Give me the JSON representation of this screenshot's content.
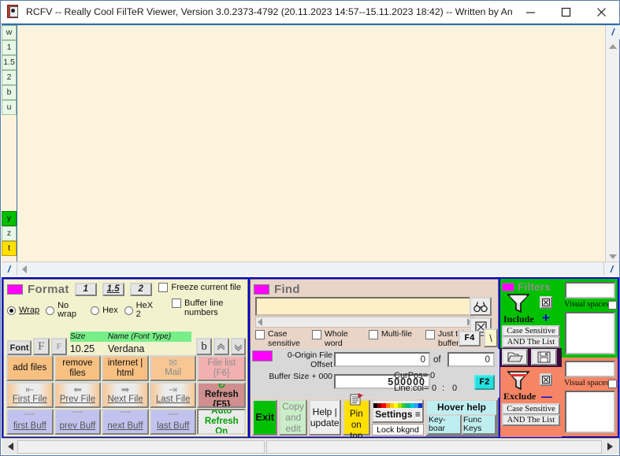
{
  "window": {
    "title": "RCFV -- Really Cool FilTeR Viewer, Version 3.0.2373-4792 (20.11.2023 14:57--15.11.2023 18:42) -- Written by Antho...",
    "icon": "book-icon",
    "minimize": "minimize-icon",
    "maximize": "maximize-icon",
    "close": "close-icon"
  },
  "viewer": {
    "content": "",
    "gutter_buttons": [
      {
        "label": "w",
        "style": "plain"
      },
      {
        "label": "1",
        "style": "plain"
      },
      {
        "label": "1.5",
        "style": "plain"
      },
      {
        "label": "2",
        "style": "plain"
      },
      {
        "label": "b",
        "style": "plain"
      },
      {
        "label": "u",
        "style": "plain"
      }
    ],
    "gutter_buttons_lower": [
      {
        "label": "y",
        "style": "green"
      },
      {
        "label": "z",
        "style": "plain"
      },
      {
        "label": "t",
        "style": "yellow"
      }
    ],
    "slash_label": "/"
  },
  "format": {
    "title": "Format",
    "size_buttons": [
      "1",
      "1.5",
      "2"
    ],
    "radios": [
      {
        "label": "Wrap",
        "selected": true
      },
      {
        "label": "No wrap",
        "selected": false
      },
      {
        "label": "Hex",
        "selected": false
      },
      {
        "label": "HeX 2",
        "selected": false
      }
    ],
    "freeze_label": "Freeze current file",
    "freeze_checked": false,
    "buffer_lines_label": "Buffer line numbers",
    "buffer_lines_checked": false,
    "font_button": "Font",
    "f_big": "F",
    "f_small": "F",
    "header_size": "Size",
    "header_name": "Name (Font Type)",
    "font_size": "10.25",
    "font_name": "Verdana",
    "bold_button": "b",
    "up_button": "chevron-up",
    "down_button": "chevron-down"
  },
  "file_buttons": {
    "row1": [
      {
        "label": "add files",
        "name": "add-files-button"
      },
      {
        "label": "remove files",
        "name": "remove-files-button"
      },
      {
        "label": "internet | html",
        "name": "internet-html-button"
      },
      {
        "label": "Mail",
        "name": "mail-button"
      },
      {
        "label": "File list {F6}",
        "name": "file-list-button"
      }
    ],
    "row2": [
      {
        "label": "First File",
        "name": "first-file-button"
      },
      {
        "label": "Prev File",
        "name": "prev-file-button"
      },
      {
        "label": "Next File",
        "name": "next-file-button"
      },
      {
        "label": "Last File",
        "name": "last-file-button"
      },
      {
        "label": "Refresh {F5}",
        "name": "refresh-button"
      }
    ],
    "row3": [
      {
        "label": "first Buff",
        "name": "first-buff-button"
      },
      {
        "label": "prev Buff",
        "name": "prev-buff-button"
      },
      {
        "label": "next Buff",
        "name": "next-buff-button"
      },
      {
        "label": "last Buff",
        "name": "last-buff-button"
      },
      {
        "label": "Auto Refresh On",
        "name": "auto-refresh-button"
      }
    ]
  },
  "find": {
    "title": "Find",
    "query": "",
    "placeholder": "",
    "search_icon": "binoculars-icon",
    "clear_icon": "clear-search-icon",
    "checkboxes": [
      {
        "label": "Case sensitive",
        "checked": false
      },
      {
        "label": "Whole word",
        "checked": false
      },
      {
        "label": "Multi-file",
        "checked": false
      },
      {
        "label": "Just this buffer",
        "checked": false
      }
    ],
    "f4_label": "F4",
    "backslash_label": "\\"
  },
  "offset": {
    "origin_label": "0-Origin File Offset",
    "origin_value": "0",
    "of_label": "of",
    "of_value": "0",
    "buffer_size_label": "Buffer Size + 000",
    "buffer_size_value": "500000",
    "curpos_label": "CurPos=",
    "curpos_value": "0",
    "linecol_label": "Line:col=",
    "line_value": "0",
    "col_sep": ":",
    "col_value": "0",
    "f2_label": "F2"
  },
  "actions": {
    "exit": "Exit",
    "copy_edit": "Copy and edit",
    "help_update": "Help | update",
    "pin_on_top": "Pin on top",
    "settings": "Settings ≡",
    "lock_bkgnd": "Lock bkgnd",
    "hover_help": "Hover help",
    "keyboard": "Key-boar",
    "func_keys": "Func Keys",
    "colorbar": [
      "#000000",
      "#8b0000",
      "#ff0000",
      "#ff7f00",
      "#ffcc00",
      "#ffff00",
      "#aadd00",
      "#33cc33",
      "#00bb88",
      "#00cccc",
      "#3399ff",
      "#0033cc"
    ]
  },
  "filters": {
    "title": "Filters",
    "include": {
      "label": "Include",
      "funnel_icon": "funnel-icon",
      "clear_icon": "clear-filter-icon",
      "add_icon": "+",
      "case_sensitive": "Case Sensitive",
      "and_the_list": "AND The List",
      "visual_spaces": "Visual spaces?",
      "small_value": "",
      "big_value": ""
    },
    "exclude": {
      "label": "Exclude",
      "funnel_icon": "funnel-icon",
      "clear_icon": "clear-filter-icon",
      "remove_icon": "—",
      "case_sensitive": "Case Sensitive",
      "and_the_list": "AND The List",
      "visual_spaces": "Visual spaces?",
      "small_value": "",
      "big_value": ""
    },
    "open_icon": "open-folder-icon",
    "save_icon": "save-icon"
  },
  "colors": {
    "accent_magenta": "#ff00ff",
    "panel_border_blue": "#0000e0",
    "include_green": "#00c000",
    "exclude_salmon": "#f58564",
    "viewer_bg": "#fdf3dc"
  }
}
